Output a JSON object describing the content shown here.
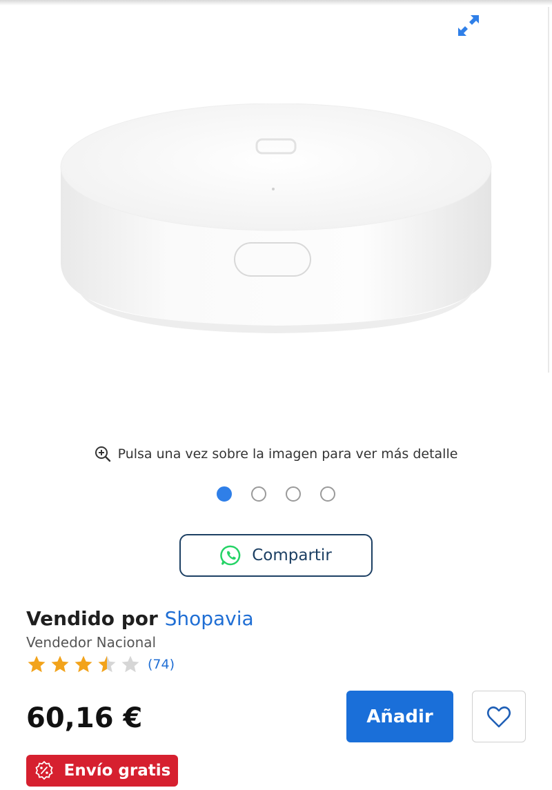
{
  "gallery": {
    "image_alt": "Product image",
    "zoom_hint": "Pulsa una vez sobre la imagen para ver más detalle",
    "dots": [
      true,
      false,
      false,
      false
    ]
  },
  "share": {
    "label": "Compartir"
  },
  "seller": {
    "prefix": "Vendido por",
    "name": "Shopavia",
    "type": "Vendedor Nacional",
    "rating": 3.5,
    "rating_max": 5,
    "review_count": "(74)"
  },
  "price": {
    "amount": "60,16 €"
  },
  "actions": {
    "add_label": "Añadir"
  },
  "badge": {
    "shipping": "Envío gratis"
  },
  "colors": {
    "accent": "#1a6fd9",
    "link": "#1f6ed4",
    "star": "#f2a31b",
    "badge": "#d6202f",
    "share_border": "#1c3f63",
    "whatsapp": "#25d366"
  },
  "icons": {
    "expand": "expand-icon",
    "zoom": "zoom-in-icon",
    "share": "whatsapp-icon",
    "favorite": "heart-icon",
    "badge": "discount-icon"
  }
}
